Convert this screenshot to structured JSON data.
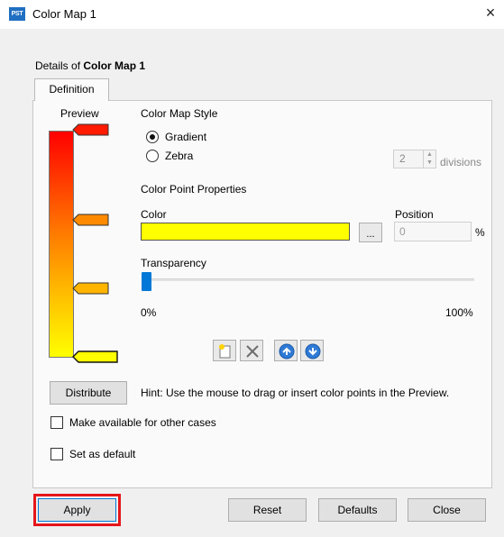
{
  "window": {
    "app_icon_text": "PST",
    "title": "Color Map 1",
    "close_glyph": "×"
  },
  "details": {
    "prefix": "Details of ",
    "name": "Color Map 1"
  },
  "tabs": [
    {
      "label": "Definition",
      "active": true
    }
  ],
  "preview": {
    "label": "Preview",
    "gradient_colors": [
      "#ff0000",
      "#ff7a00",
      "#ffb800",
      "#ffff00"
    ]
  },
  "style": {
    "heading": "Color Map Style",
    "options": [
      {
        "label": "Gradient",
        "selected": true
      },
      {
        "label": "Zebra",
        "selected": false
      }
    ],
    "divisions_value": "2",
    "divisions_label": "divisions"
  },
  "color_point": {
    "heading": "Color Point Properties",
    "color_label": "Color",
    "color_value": "#ffff00",
    "picker_label": "...",
    "position_label": "Position",
    "position_value": "0",
    "position_unit": "%",
    "transparency_label": "Transparency",
    "transparency_value": 0,
    "min_label": "0%",
    "max_label": "100%"
  },
  "tools": {
    "icons": [
      "new-point-icon",
      "delete-icon",
      "move-up-icon",
      "move-down-icon"
    ]
  },
  "distribute": {
    "button_label": "Distribute",
    "hint": "Hint: Use the mouse to drag or insert color points in the Preview."
  },
  "options": {
    "available_label": "Make available for other cases",
    "available_checked": false,
    "default_label": "Set as default",
    "default_checked": false
  },
  "footer": {
    "apply_label": "Apply",
    "reset_label": "Reset",
    "defaults_label": "Defaults",
    "close_label": "Close"
  },
  "colors": {
    "accent": "#0078d7",
    "highlight": "#e5161b"
  }
}
